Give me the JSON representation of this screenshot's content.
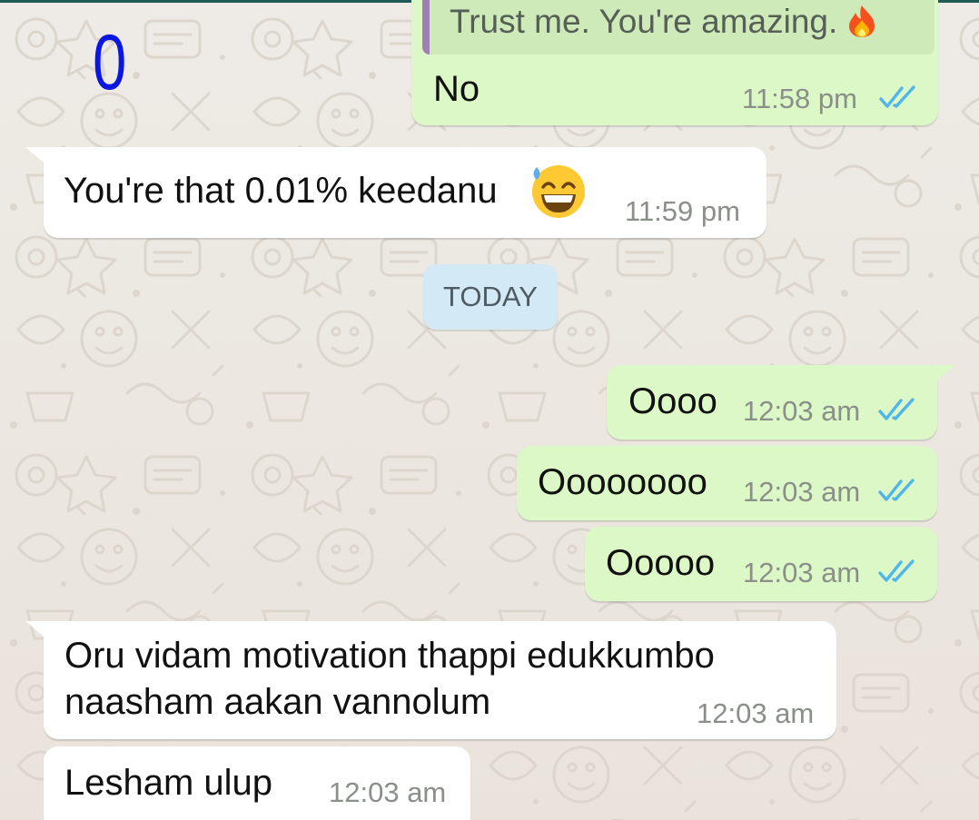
{
  "annotation": "0",
  "date_separator": "TODAY",
  "messages": [
    {
      "id": "m1",
      "direction": "out",
      "quoted_text": "Trust me. You're amazing.",
      "quoted_emoji": "fire-emoji",
      "text": "No",
      "time": "11:58 pm",
      "status": "read"
    },
    {
      "id": "m2",
      "direction": "in",
      "text": "You're that 0.01% keedanu",
      "emoji": "grinning-face-with-sweat-emoji",
      "time": "11:59 pm"
    },
    {
      "id": "m3",
      "direction": "out",
      "text": "Oooo",
      "time": "12:03 am",
      "status": "read"
    },
    {
      "id": "m4",
      "direction": "out",
      "text": "Oooooooo",
      "time": "12:03 am",
      "status": "read"
    },
    {
      "id": "m5",
      "direction": "out",
      "text": "Ooooo",
      "time": "12:03 am",
      "status": "read"
    },
    {
      "id": "m6",
      "direction": "in",
      "text_lines": [
        "Oru vidam motivation thappi edukkumbo",
        "naasham aakan vannolum"
      ],
      "time": "12:03 am"
    },
    {
      "id": "m7",
      "direction": "in",
      "text": "Lesham ulup",
      "time": "12:03 am"
    }
  ],
  "colors": {
    "wallpaper": "#ece5dd",
    "incoming_bubble": "#ffffff",
    "outgoing_bubble": "#dcf8c6",
    "read_ticks": "#4fb6ec",
    "date_chip": "#d4e9f6",
    "quote_bar": "#a07fb6"
  }
}
